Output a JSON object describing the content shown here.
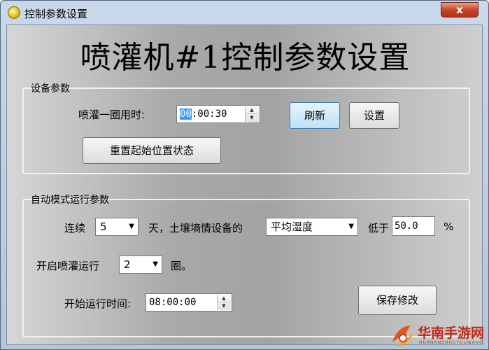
{
  "window": {
    "title": "控制参数设置",
    "close_label": "x"
  },
  "main": {
    "big_title": "喷灌机#1控制参数设置"
  },
  "device_params": {
    "legend": "设备参数",
    "cycle_time_label": "喷灌一圈用时:",
    "cycle_time_hl": "00",
    "cycle_time_rest": ":00:30",
    "refresh_label": "刷新",
    "set_label": "设置",
    "reset_label": "重置起始位置状态"
  },
  "auto_mode": {
    "legend": "自动模式运行参数",
    "consecutive_label": "连续",
    "days_value": "5",
    "days_suffix": "天，土壤墒情设备的",
    "metric_value": "平均湿度",
    "below_label": "低于",
    "threshold_value": "50.0",
    "percent_label": "%",
    "start_run_label": "开启喷灌运行",
    "rounds_value": "2",
    "rounds_suffix": "圈。",
    "start_time_label": "开始运行时间:",
    "start_time_value": "08:00:00",
    "save_label": "保存修改"
  },
  "watermark": {
    "text": "华南手游网",
    "sub": "HUANANSHOUYOUWANG"
  },
  "icons": {
    "up": "▲",
    "down": "▼",
    "dropdown": "▼"
  }
}
